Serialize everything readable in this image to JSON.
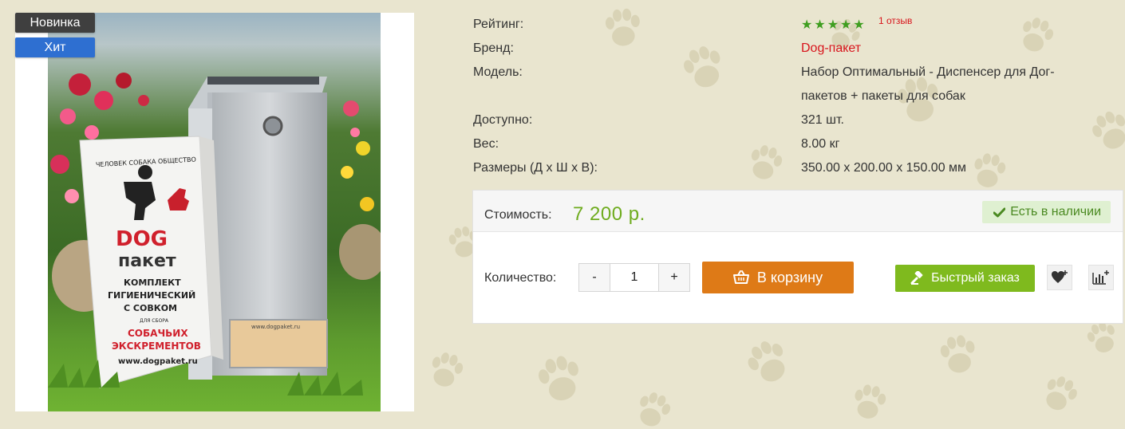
{
  "badges": {
    "new": "Новинка",
    "hit": "Хит"
  },
  "photo_text": {
    "arc": "ЧЕЛОВЕК  СОБАКА  ОБЩЕСТВО",
    "logo_dog": "DOG",
    "logo_paket": "пакет",
    "line1": "КОМПЛЕКТ",
    "line2": "ГИГИЕНИЧЕСКИЙ",
    "line3": "С СОВКОМ",
    "line4": "ДЛЯ СБОРА",
    "line5": "СОБАЧЬИХ",
    "line6": "ЭКСКРЕМЕНТОВ",
    "url": "www.dogpaket.ru",
    "url_small": "www.dogpaket.ru"
  },
  "specs": {
    "rating_label": "Рейтинг:",
    "rating_value": 5,
    "reviews": "1 отзыв",
    "brand_label": "Бренд:",
    "brand_value": "Dog-пакет",
    "model_label": "Модель:",
    "model_value": "Набор Оптимальный - Диспенсер для Дог-пакетов + пакеты для собак",
    "available_label": "Доступно:",
    "available_value": "321 шт.",
    "weight_label": "Вес:",
    "weight_value": "8.00 кг",
    "size_label": "Размеры (Д х Ш х В):",
    "size_value": "350.00 x 200.00 x 150.00 мм"
  },
  "purchase": {
    "price_label": "Стоимость:",
    "price_value": "7 200 р.",
    "stock_label": "Есть в наличии",
    "qty_label": "Количество:",
    "qty_minus": "-",
    "qty_value": "1",
    "qty_plus": "+",
    "cart_label": "В корзину",
    "quick_label": "Быстрый заказ"
  },
  "colors": {
    "accent_orange": "#de7a17",
    "price_green": "#6fac1f",
    "quick_green": "#7fba1e",
    "brand_red": "#d8141b",
    "star_green": "#3f9e20"
  },
  "icons": [
    "star-icon",
    "check-icon",
    "basket-icon",
    "gavel-icon",
    "heart-plus-icon",
    "compare-chart-icon"
  ]
}
